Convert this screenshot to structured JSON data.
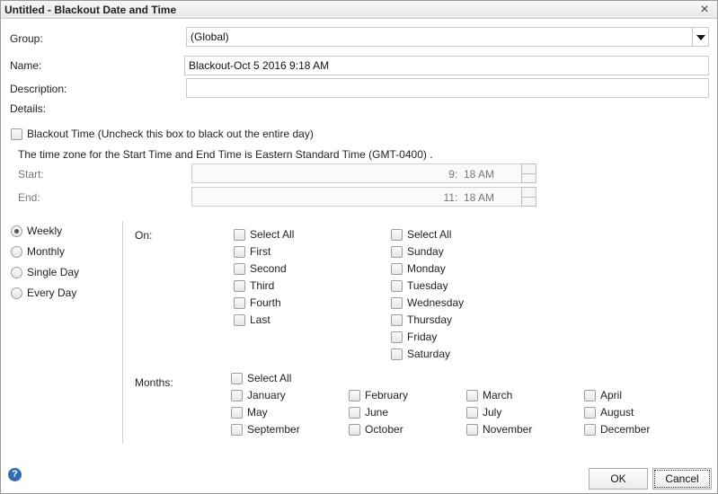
{
  "window": {
    "title": "Untitled - Blackout Date and Time",
    "close_glyph": "×"
  },
  "form": {
    "group_label": "Group:",
    "group_value": "(Global)",
    "name_label": "Name:",
    "name_value": "Blackout-Oct 5 2016 9:18 AM",
    "description_label": "Description:",
    "description_value": "",
    "details_label": "Details:"
  },
  "blackout_time": {
    "label": "Blackout Time (Uncheck this box to black out the entire day)",
    "checked": false,
    "timezone_note": "The time zone for the Start Time and End Time is Eastern Standard Time (GMT-0400) .",
    "start_label": "Start:",
    "start_hour": "9",
    "start_minute": "18",
    "start_ampm": "AM",
    "end_label": "End:",
    "end_hour": "11",
    "end_minute": "18",
    "end_ampm": "AM",
    "colon": ":"
  },
  "recurrence": {
    "selected": "Weekly",
    "options": [
      "Weekly",
      "Monthly",
      "Single Day",
      "Every Day"
    ]
  },
  "on": {
    "label": "On:",
    "ordinals": [
      "Select All",
      "First",
      "Second",
      "Third",
      "Fourth",
      "Last"
    ],
    "days": [
      "Select All",
      "Sunday",
      "Monday",
      "Tuesday",
      "Wednesday",
      "Thursday",
      "Friday",
      "Saturday"
    ]
  },
  "months": {
    "label": "Months:",
    "select_all": "Select All",
    "items": [
      "January",
      "February",
      "March",
      "April",
      "May",
      "June",
      "July",
      "August",
      "September",
      "October",
      "November",
      "December"
    ]
  },
  "buttons": {
    "ok": "OK",
    "cancel": "Cancel",
    "help_glyph": "?"
  },
  "icons": {
    "close": "close-icon",
    "help": "help-icon",
    "dropdown": "chevron-down-icon"
  }
}
